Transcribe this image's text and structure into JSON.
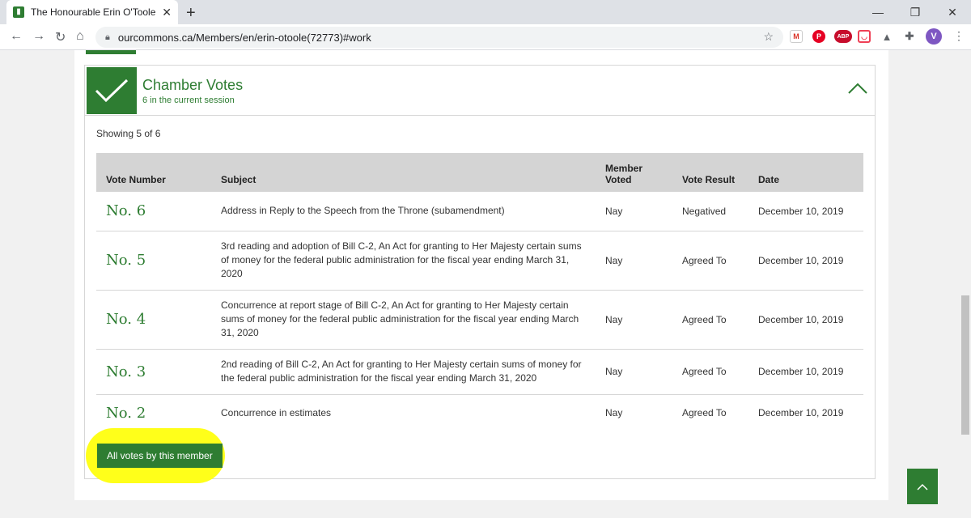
{
  "browser": {
    "tab_title": "The Honourable Erin O'Toole - M",
    "url": "ourcommons.ca/Members/en/erin-otoole(72773)#work",
    "extensions": [
      "gmail-icon",
      "pinterest-icon",
      "adblock-plus-icon",
      "pocket-icon",
      "drive-icon",
      "puzzle-icon",
      "profile-avatar"
    ],
    "profile_initial": "V",
    "abp_label": "ABP"
  },
  "panel": {
    "title": "Chamber Votes",
    "subtitle": "6 in the current session",
    "showing": "Showing 5 of 6"
  },
  "table": {
    "headers": {
      "vote_number": "Vote Number",
      "subject": "Subject",
      "member_voted_line1": "Member",
      "member_voted_line2": "Voted",
      "vote_result": "Vote Result",
      "date": "Date"
    },
    "rows": [
      {
        "number": "No. 6",
        "subject": "Address in Reply to the Speech from the Throne (subamendment)",
        "voted": "Nay",
        "result": "Negatived",
        "date": "December 10, 2019"
      },
      {
        "number": "No. 5",
        "subject": "3rd reading and adoption of Bill C-2, An Act for granting to Her Majesty certain sums of money for the federal public administration for the fiscal year ending March 31, 2020",
        "voted": "Nay",
        "result": "Agreed To",
        "date": "December 10, 2019"
      },
      {
        "number": "No. 4",
        "subject": "Concurrence at report stage of Bill C-2, An Act for granting to Her Majesty certain sums of money for the federal public administration for the fiscal year ending March 31, 2020",
        "voted": "Nay",
        "result": "Agreed To",
        "date": "December 10, 2019"
      },
      {
        "number": "No. 3",
        "subject": "2nd reading of Bill C-2, An Act for granting to Her Majesty certain sums of money for the federal public administration for the fiscal year ending March 31, 2020",
        "voted": "Nay",
        "result": "Agreed To",
        "date": "December 10, 2019"
      },
      {
        "number": "No. 2",
        "subject": "Concurrence in estimates",
        "voted": "Nay",
        "result": "Agreed To",
        "date": "December 10, 2019"
      }
    ]
  },
  "all_votes_button": "All votes by this member",
  "colors": {
    "accent": "#2e7d32",
    "highlight": "#ffff1a",
    "header_bg": "#d4d4d4"
  }
}
